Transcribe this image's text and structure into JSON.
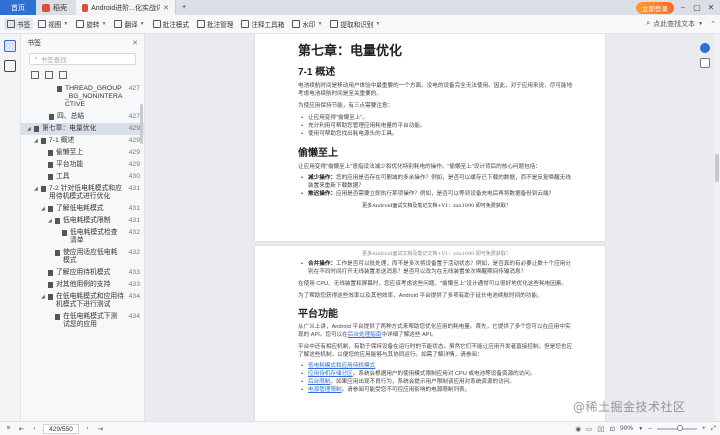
{
  "tabs": [
    {
      "label": "首页"
    },
    {
      "label": "稻壳"
    },
    {
      "label": "Android进阶...化实战详解.pdf"
    }
  ],
  "window": {
    "login_label": "立即登录"
  },
  "toolbar": {
    "items": [
      "书签",
      "视图",
      "旋转",
      "翻译",
      "批注模式",
      "批注管理",
      "注释工具箱",
      "水印",
      "提取和识别"
    ],
    "search_placeholder": "点此查找文本"
  },
  "sidebar": {
    "title": "书签",
    "search_placeholder": "书签查找",
    "items": [
      {
        "label": "THREAD_GROUP_BG_NONINTERACTIVE",
        "page": "427"
      },
      {
        "label": "四、总结",
        "page": "427"
      },
      {
        "label": "第七章：电量优化",
        "page": "429"
      },
      {
        "label": "7-1 概述",
        "page": "429"
      },
      {
        "label": "偷懒至上",
        "page": "429"
      },
      {
        "label": "平台功能",
        "page": "429"
      },
      {
        "label": "工具",
        "page": "430"
      },
      {
        "label": "7-2 针对低电耗模式和应用待机模式进行优化",
        "page": "431"
      },
      {
        "label": "了解低电耗模式",
        "page": "431"
      },
      {
        "label": "低电耗模式限制",
        "page": "431"
      },
      {
        "label": "低电耗模式检查清单",
        "page": "432"
      },
      {
        "label": "使应用适应低电耗模式",
        "page": "432"
      },
      {
        "label": "了解应用待机模式",
        "page": "433"
      },
      {
        "label": "对其他用例的支持",
        "page": "433"
      },
      {
        "label": "在低电耗模式和应用待机模式下进行测试",
        "page": "434"
      },
      {
        "label": "在低电耗模式下测试您的应用",
        "page": "434"
      },
      {
        "label": "在应用待机模式下测试您的应用",
        "page": "435"
      },
      {
        "label": "列入白名单的可接受用例",
        "page": "435"
      }
    ]
  },
  "page1": {
    "chapter_title": "第七章：电量优化",
    "section_title": "7-1 概述",
    "intro": "电池续航时间是移动用户体验中最重要的一个方面。没电的设备完全无法使用。因此，对于应用来说，尽可能地考虑电池续航时间是至关重要的。",
    "principles_lead": "为使应用保持节能，有三点需要注意：",
    "principles": [
      "让应用变得\"偷懒至上\"。",
      "充分利用可帮助您管理应用耗电量的平台功能。",
      "使用可帮助您找出耗电源头的工具。"
    ],
    "lazy_title": "偷懒至上",
    "lazy_intro": "让应用变得\"偷懒至上\"意指设法减少和优化特别耗电的操作。\"偷懒至上\"设计背后的核心问题包括：",
    "lazy_items": [
      {
        "term": "减少操作：",
        "text": "您的应用是否存在可删减的多余操作？例如，是否可以缓存已下载的数据，而不是反复唤醒无线装置来重新下载数据？"
      },
      {
        "term": "推迟操作：",
        "text": "应用是否需要立即执行某项操作？例如，是否可以等到设备充电后再将数据备份到云端？"
      }
    ],
    "footer": "更多Android面试文档及笔记文档+V1：zxx1090 即可免费获取！"
  },
  "page2": {
    "header_overlap": "更多Android面试文档及笔记文档+V1：zxx1090 即可免费获取！",
    "items": [
      {
        "term": "合并操作：",
        "text": "工作是否可以批处理，而不是多次将设备置于活动状态？例如，是否真的有必要让数十个应用分别在不同时间打开无线装置发送消息？是否可以改为在无线装置单次唤醒期间传输消息？"
      }
    ],
    "para1": "在使用 CPU、无线装置和屏幕时，您应该考虑这些问题。\"偷懒至上\"设计通常可以很好地优化这些耗电因素。",
    "para2": "为了帮助您获得这些效率以及其他效率，Android 平台提供了多项有助于延长电池续航时间的功能。",
    "platform_title": "平台功能",
    "platform_p1_a": "从广义上讲，Android 平台提供了两种方式来帮助您优化应用的耗电量。首先，它提供了多个您可以在应用中实现的 API。您可以在",
    "platform_p1_link": "后台处理指南",
    "platform_p1_b": "中详细了解这些 API。",
    "platform_p2": "平台中还有相应机制，有助于保持设备在运行时的节能状态。虽然它们不能让应用开发者直接控制，但是您也应了解这些机制，以便您的应用能够与其协同运行。如需了解详情，请参阅：",
    "links": [
      {
        "link": "低电耗模式和应用待机模式",
        "text": ""
      },
      {
        "link": "应用待机存储分区",
        "text": "。系统会根据用户的使用模式限制应用对 CPU 或电池等设备资源的访问。"
      },
      {
        "link": "后台限制",
        "text": "。如果应用出现不良行为，系统会提示用户限制该应用对系统资源的访问。"
      },
      {
        "link": "电源管理限制",
        "text": "。请参阅可能受您不可控应用影响的电源限制列表。"
      }
    ]
  },
  "status": {
    "page_indicator": "429/550",
    "zoom": "90%"
  },
  "watermark": "@稀土掘金技术社区"
}
